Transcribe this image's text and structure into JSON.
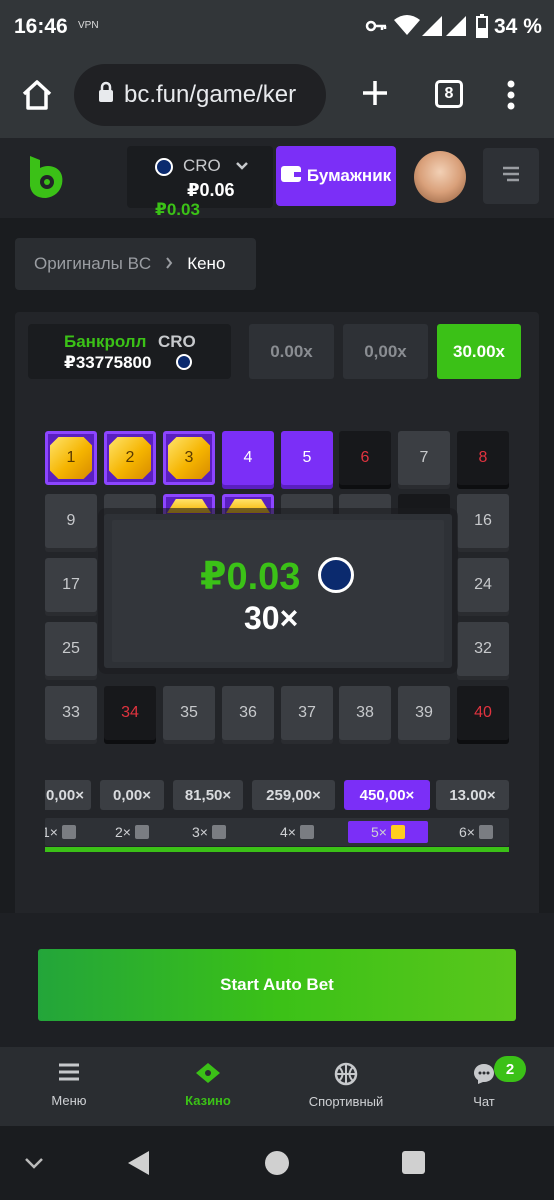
{
  "status": {
    "time": "16:46",
    "vpn": "VPN",
    "battery": "34 %"
  },
  "browser": {
    "url": "bc.fun/game/ker",
    "tab_count": "8"
  },
  "header": {
    "currency": "CRO",
    "balance": "₽0.06",
    "balance_change": "₽0.03",
    "wallet_label": "Бумажник"
  },
  "breadcrumb": {
    "parent": "Оригиналы BC",
    "current": "Кено"
  },
  "bankroll": {
    "label": "Банкролл",
    "currency": "CRO",
    "value": "₽33775800"
  },
  "multipliers": [
    "0.00x",
    "0,00x",
    "30.00x"
  ],
  "grid": {
    "n1": "1",
    "n2": "2",
    "n3": "3",
    "n4": "4",
    "n5": "5",
    "n6": "6",
    "n7": "7",
    "n8": "8",
    "n9": "9",
    "n16": "16",
    "n17": "17",
    "n24": "24",
    "n25": "25",
    "n32": "32",
    "n33": "33",
    "n34": "34",
    "n35": "35",
    "n36": "36",
    "n37": "37",
    "n38": "38",
    "n39": "39",
    "n40": "40"
  },
  "result": {
    "amount": "₽0.03",
    "multiplier": "30×"
  },
  "payouts": [
    "0,00×",
    "0,00×",
    "81,50×",
    "259,00×",
    "450,00×",
    "13.00×"
  ],
  "hits": [
    "1×",
    "2×",
    "3×",
    "4×",
    "5×",
    "6×"
  ],
  "action": {
    "auto_bet": "Start Auto Bet"
  },
  "nav": {
    "menu": "Меню",
    "casino": "Казино",
    "sports": "Спортивный",
    "chat": "Чат",
    "chat_badge": "2"
  },
  "colors": {
    "accent_green": "#3bc117",
    "accent_purple": "#7b2ff7",
    "danger_red": "#e0333f"
  }
}
